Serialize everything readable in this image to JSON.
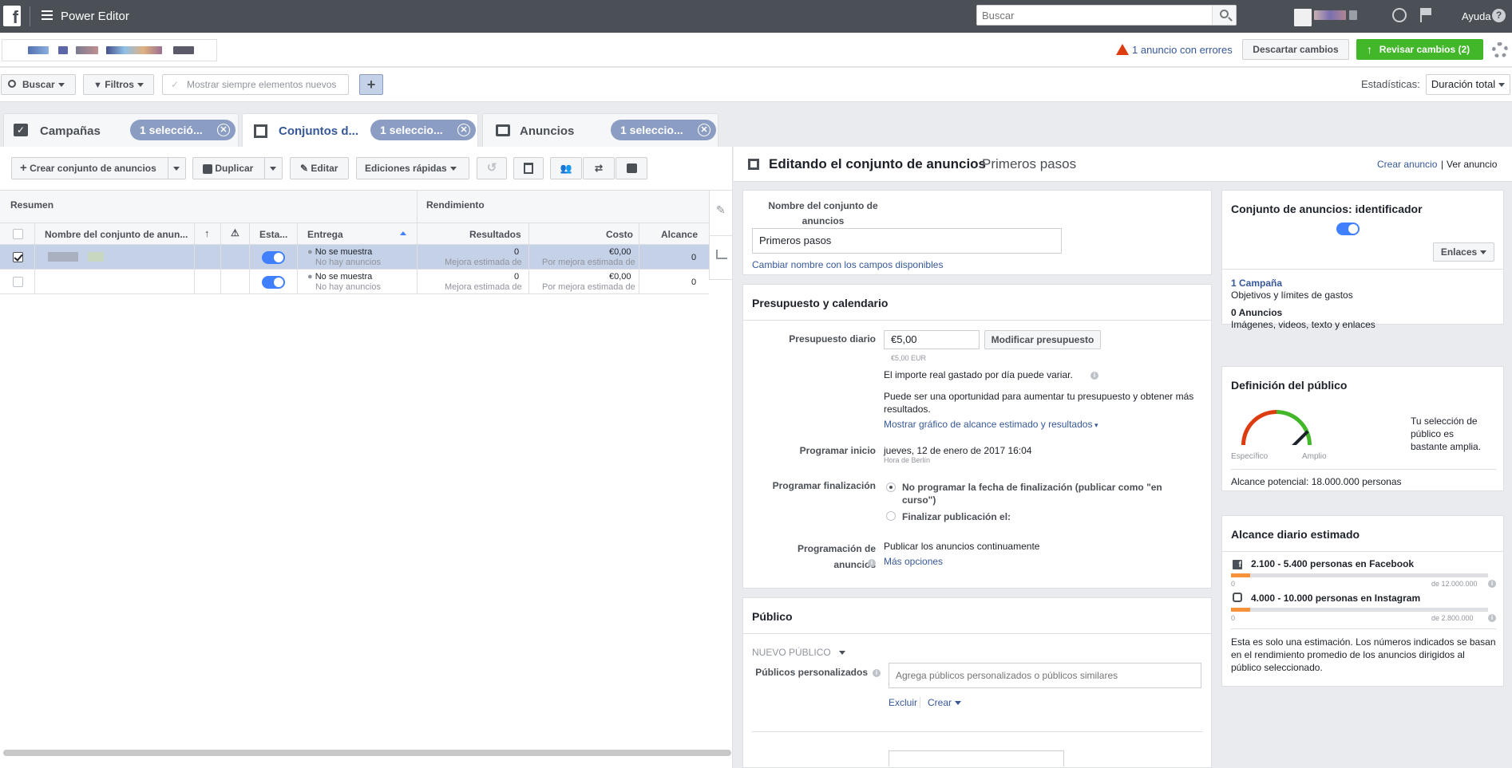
{
  "topbar": {
    "app_title": "Power Editor",
    "search_placeholder": "Buscar",
    "help_label": "Ayuda",
    "help_icon": "?"
  },
  "accountbar": {
    "error_text": "1 anuncio con errores",
    "discard_label": "Descartar cambios",
    "review_label": "Revisar cambios (2)"
  },
  "filterbar": {
    "search_label": "Buscar",
    "filters_label": "Filtros",
    "show_new_label": "Mostrar siempre elementos nuevos",
    "plus_label": "+",
    "stats_label": "Estadísticas:",
    "stats_value": "Duración total"
  },
  "tabs": [
    {
      "label": "Campañas",
      "pill": "1 selecció...",
      "active": false
    },
    {
      "label": "Conjuntos d...",
      "pill": "1 seleccio...",
      "active": true
    },
    {
      "label": "Anuncios",
      "pill": "1 seleccio...",
      "active": false
    }
  ],
  "toolbar": {
    "create_label": "Crear conjunto de anuncios",
    "duplicate_label": "Duplicar",
    "edit_label": "Editar",
    "quick_edits_label": "Ediciones rápidas"
  },
  "grid": {
    "group_summary": "Resumen",
    "group_performance": "Rendimiento",
    "columns": [
      "Nombre del conjunto de anun...",
      "Esta...",
      "Entrega",
      "Resultados",
      "Costo",
      "Alcance"
    ],
    "rows": [
      {
        "selected": true,
        "delivery": "No se muestra",
        "delivery_sub": "No hay anuncios",
        "results": "0",
        "results_sub": "Mejora estimada de",
        "cost": "€0,00",
        "cost_sub": "Por mejora estimada de",
        "reach": "0"
      },
      {
        "selected": false,
        "delivery": "No se muestra",
        "delivery_sub": "No hay anuncios",
        "results": "0",
        "results_sub": "Mejora estimada de",
        "cost": "€0,00",
        "cost_sub": "Por mejora estimada de",
        "reach": "0"
      }
    ]
  },
  "editor": {
    "heading": "Editando el conjunto de anuncios",
    "heading_name": "Primeros pasos",
    "create_ad_link": "Crear anuncio",
    "separator": "|",
    "view_ad_link": "Ver anuncio",
    "name_label": "Nombre del conjunto de anuncios",
    "name_value": "Primeros pasos",
    "rename_link": "Cambiar nombre con los campos disponibles",
    "budget": {
      "title": "Presupuesto y calendario",
      "daily_label": "Presupuesto diario",
      "daily_value": "€5,00",
      "modify_label": "Modificar presupuesto",
      "daily_sub": "€5,00 EUR",
      "note1": "El importe real gastado por día puede variar.",
      "note2": "Puede ser una oportunidad para aumentar tu presupuesto y obtener más resultados.",
      "show_chart_link": "Mostrar gráfico de alcance estimado y resultados",
      "start_label": "Programar inicio",
      "start_value": "jueves, 12 de enero de 2017 16:04",
      "start_tz": "Hora de Berlín",
      "end_label": "Programar finalización",
      "end_opt1": "No programar la fecha de finalización (publicar como \"en curso\")",
      "end_opt2": "Finalizar publicación el:",
      "ads_sched_label": "Programación de anuncios",
      "ads_sched_value": "Publicar los anuncios continuamente",
      "more_options_link": "Más opciones"
    },
    "audience": {
      "title": "Público",
      "new_audience": "NUEVO PÚBLICO",
      "custom_label": "Públicos personalizados",
      "custom_placeholder": "Agrega públicos personalizados o públicos similares",
      "exclude_link": "Excluir",
      "create_link": "Crear"
    }
  },
  "sidebar": {
    "identifier_title": "Conjunto de anuncios: identificador",
    "links_label": "Enlaces",
    "campaign_link": "1 Campaña",
    "campaign_sub": "Objetivos y límites de gastos",
    "ads_count": "0 Anuncios",
    "ads_sub": "Imágenes, videos, texto y enlaces",
    "audience_def_title": "Definición del público",
    "gauge_specific": "Específico",
    "gauge_broad": "Amplio",
    "audience_def_text": "Tu selección de público es bastante amplia.",
    "potential_reach": "Alcance potencial: 18.000.000 personas",
    "daily_reach_title": "Alcance diario estimado",
    "fb_reach": "2.100 - 5.400 personas en Facebook",
    "fb_min": "0",
    "fb_max": "de 12.000.000",
    "ig_reach": "4.000 - 10.000 personas en Instagram",
    "ig_min": "0",
    "ig_max": "de 2.800.000",
    "estimate_note": "Esta es solo una estimación. Los números indicados se basan en el rendimiento promedio de los anuncios dirigidos al público seleccionado."
  },
  "colors": {
    "accent": "#4080ff",
    "link": "#365899",
    "green": "#42b72a",
    "topbar": "#4b4f56"
  }
}
